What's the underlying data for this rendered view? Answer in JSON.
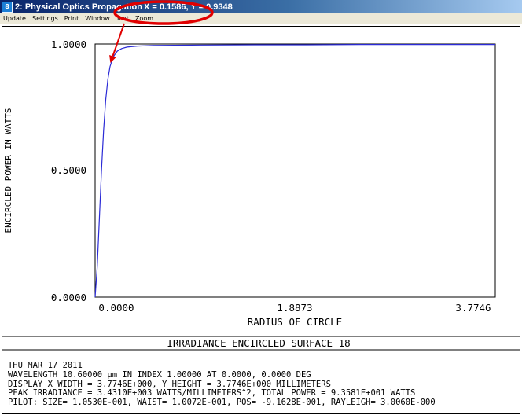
{
  "window": {
    "title": "2: Physical Optics Propagation",
    "coordinate_readout": "X = 0.1586, Y = 0.9348",
    "icon_name": "zemax-app-icon"
  },
  "menu": [
    "Update",
    "Settings",
    "Print",
    "Window",
    "Text",
    "Zoom"
  ],
  "plot": {
    "title": "IRRADIANCE ENCIRCLED SURFACE 18",
    "colors": {
      "curve": "#2b2bd6",
      "annotation": "#e00000"
    }
  },
  "chart_data": {
    "type": "line",
    "xlabel": "RADIUS OF CIRCLE",
    "ylabel": "ENCIRCLED POWER IN WATTS",
    "xlim": [
      0,
      3.7746
    ],
    "ylim": [
      0,
      1.0
    ],
    "x_ticks": [
      "0.0000",
      "1.8873",
      "3.7746"
    ],
    "y_ticks": [
      "0.0000",
      "0.5000",
      "1.0000"
    ],
    "series": [
      {
        "x": [
          0.0,
          0.02,
          0.04,
          0.06,
          0.08,
          0.1,
          0.12,
          0.14,
          0.1586,
          0.18,
          0.21,
          0.25,
          0.3,
          0.4,
          0.55,
          0.75,
          1.0,
          1.5,
          2.0,
          2.5,
          3.0,
          3.7746
        ],
        "y": [
          0.0,
          0.12,
          0.31,
          0.5,
          0.66,
          0.78,
          0.86,
          0.91,
          0.9348,
          0.955,
          0.972,
          0.982,
          0.988,
          0.992,
          0.994,
          0.995,
          0.996,
          0.997,
          0.997,
          0.998,
          0.998,
          0.998
        ]
      }
    ],
    "annotation": {
      "x": 0.1586,
      "y": 0.9348
    }
  },
  "info_lines": [
    "THU MAR 17 2011",
    "WAVELENGTH 10.60000 µm IN INDEX 1.00000 AT 0.0000, 0.0000 DEG",
    "DISPLAY X WIDTH = 3.7746E+000, Y HEIGHT = 3.7746E+000 MILLIMETERS",
    "PEAK IRRADIANCE = 3.4310E+003 WATTS/MILLIMETERS^2, TOTAL POWER = 9.3581E+001 WATTS",
    "PILOT: SIZE= 1.0530E-001, WAIST= 1.0072E-001, POS= -9.1628E-001, RAYLEIGH= 3.0060E-000"
  ]
}
